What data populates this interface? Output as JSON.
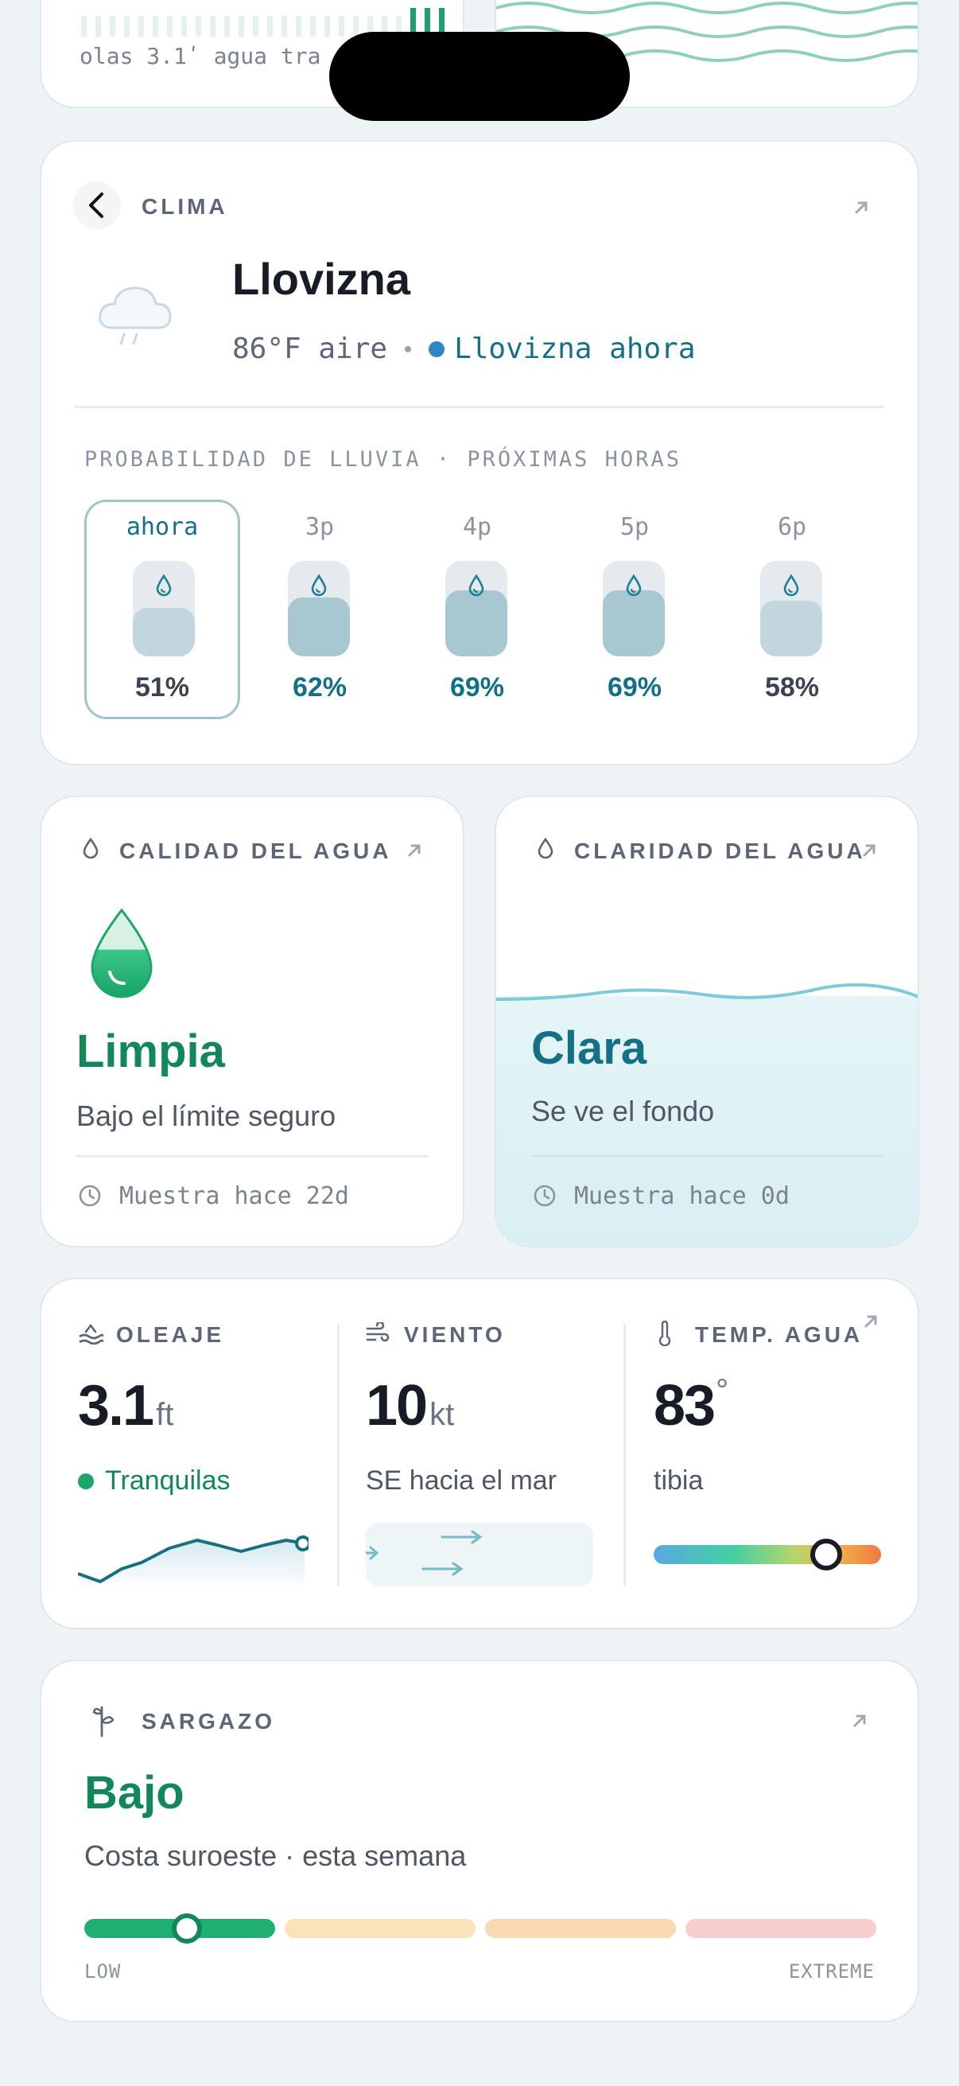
{
  "top_partial": {
    "caption": "olas 3.1ʹ  agua tra"
  },
  "weather": {
    "eyebrow": "CLIMA",
    "title": "Llovizna",
    "air": "86°F aire",
    "now_label": "Llovizna ahora",
    "rain_heading": "PROBABILIDAD DE LLUVIA · PRÓXIMAS HORAS",
    "hours": [
      {
        "label": "ahora",
        "pct": "51%",
        "value": 0.51
      },
      {
        "label": "3p",
        "pct": "62%",
        "value": 0.62
      },
      {
        "label": "4p",
        "pct": "69%",
        "value": 0.69
      },
      {
        "label": "5p",
        "pct": "69%",
        "value": 0.69
      },
      {
        "label": "6p",
        "pct": "58%",
        "value": 0.58
      }
    ]
  },
  "water_quality": {
    "eyebrow": "CALIDAD DEL AGUA",
    "status": "Limpia",
    "detail": "Bajo el límite seguro",
    "sample": "Muestra hace 22d"
  },
  "water_clarity": {
    "eyebrow": "CLARIDAD DEL AGUA",
    "status": "Clara",
    "detail": "Se ve el fondo",
    "sample": "Muestra hace 0d"
  },
  "conditions": {
    "swell": {
      "eyebrow": "OLEAJE",
      "value": "3.1",
      "unit": "ft",
      "status": "Tranquilas"
    },
    "wind": {
      "eyebrow": "VIENTO",
      "value": "10",
      "unit": "kt",
      "detail": "SE hacia el mar"
    },
    "water_temp": {
      "eyebrow": "TEMP. AGUA",
      "value": "83",
      "unit": "°",
      "detail": "tibia",
      "level": 0.76
    }
  },
  "sargassum": {
    "eyebrow": "SARGAZO",
    "status": "Bajo",
    "detail": "Costa suroeste · esta semana",
    "scale_low": "LOW",
    "scale_high": "EXTREME",
    "level": 0.13
  },
  "colors": {
    "accent_green": "#12875a",
    "accent_teal": "#137087",
    "drizzle_dot": "#2f86c5"
  }
}
